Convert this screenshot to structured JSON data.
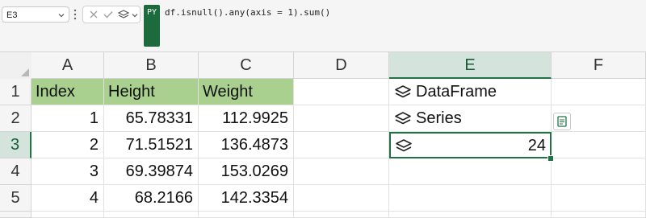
{
  "formula_bar": {
    "name_box": "E3",
    "py_badge": "PY",
    "formula": "df.isnull().any(axis = 1).sum()"
  },
  "columns": [
    "A",
    "B",
    "C",
    "D",
    "E",
    "F"
  ],
  "rows": [
    "1",
    "2",
    "3",
    "4",
    "5"
  ],
  "cells": {
    "A1": "Index",
    "B1": "Height",
    "C1": "Weight",
    "A2": "1",
    "B2": "65.78331",
    "C2": "112.9925",
    "A3": "2",
    "B3": "71.51521",
    "C3": "136.4873",
    "A4": "3",
    "B4": "69.39874",
    "C4": "153.0269",
    "A5": "4",
    "B5": "68.2166",
    "C5": "142.3354",
    "E1": "DataFrame",
    "E2": "Series",
    "E3": "24"
  },
  "colors": {
    "header_fill": "#a9d08e",
    "selection": "#217346",
    "python_badge": "#1d6b3c"
  },
  "icons": {
    "python_object": "layers-icon",
    "card": "card-icon"
  }
}
